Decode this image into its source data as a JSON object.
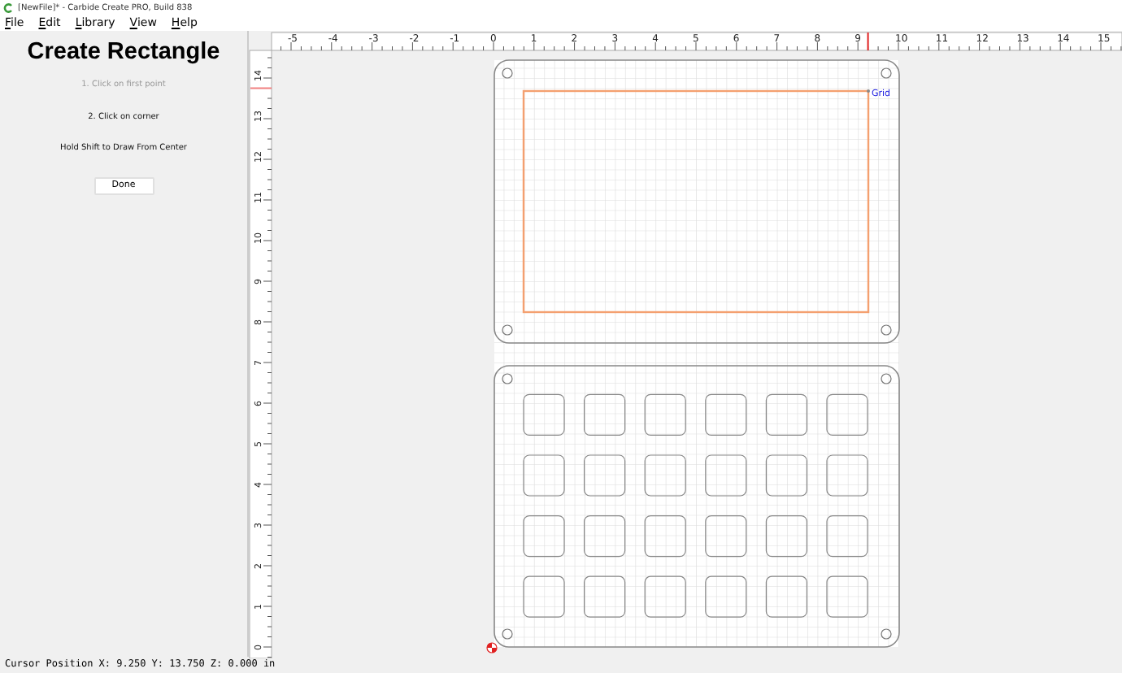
{
  "window": {
    "title": "[NewFile]* - Carbide Create PRO, Build 838"
  },
  "menu": [
    {
      "label": "File"
    },
    {
      "label": "Edit"
    },
    {
      "label": "Library"
    },
    {
      "label": "View"
    },
    {
      "label": "Help"
    }
  ],
  "panel": {
    "title": "Create Rectangle",
    "steps": [
      {
        "text": "1. Click on first point",
        "disabled": true
      },
      {
        "text": "2. Click on corner",
        "disabled": false
      },
      {
        "text": "Hold Shift to Draw From Center",
        "disabled": false
      }
    ],
    "button": "Done"
  },
  "ruler": {
    "x_labels": [
      "-5",
      "-4",
      "-3",
      "-2",
      "-1",
      "0",
      "1",
      "2",
      "3",
      "4",
      "5",
      "6",
      "7",
      "8",
      "9",
      "10",
      "11",
      "12",
      "13",
      "14",
      "15"
    ],
    "y_labels": [
      "0",
      "1",
      "2",
      "3",
      "4",
      "5",
      "6",
      "7",
      "8",
      "9",
      "10",
      "11",
      "12",
      "13",
      "14"
    ]
  },
  "canvas": {
    "grid_label": "Grid"
  },
  "status_bar": "Cursor Position X: 9.250 Y: 13.750 Z: 0.000 in"
}
